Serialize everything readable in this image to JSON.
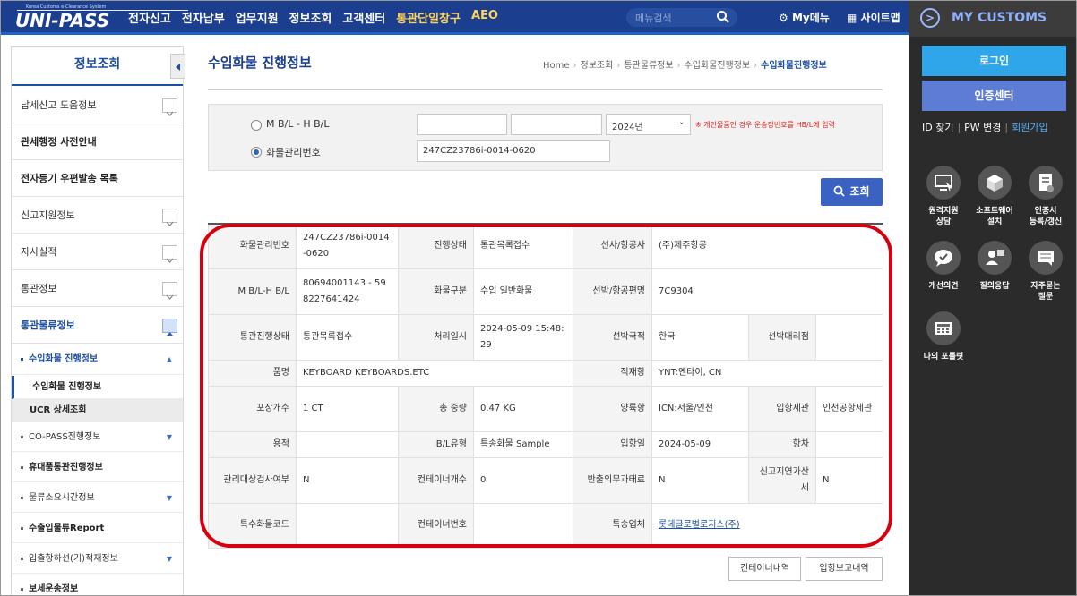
{
  "header": {
    "logo_sub": "Korea Customs e-Clearance System",
    "logo_main": "UNI-PASS",
    "nav": [
      "전자신고",
      "전자납부",
      "업무지원",
      "정보조회",
      "고객센터",
      "통관단일창구",
      "AEO"
    ],
    "search_placeholder": "메뉴검색",
    "my_menu": "My메뉴",
    "sitemap": "사이트맵"
  },
  "right_panel": {
    "title": "MY CUSTOMS",
    "login": "로그인",
    "cert_center": "인증센터",
    "links": {
      "id": "ID 찾기",
      "pw": "PW 변경",
      "join": "회원가입"
    },
    "quick": [
      {
        "label1": "원격지원",
        "label2": "상담",
        "icon": "remote-support-icon"
      },
      {
        "label1": "소프트웨어",
        "label2": "설치",
        "icon": "software-install-icon"
      },
      {
        "label1": "인증서",
        "label2": "등록/갱신",
        "icon": "certificate-icon"
      },
      {
        "label1": "개선의견",
        "label2": "",
        "icon": "feedback-icon"
      },
      {
        "label1": "질의응답",
        "label2": "",
        "icon": "qna-icon"
      },
      {
        "label1": "자주묻는",
        "label2": "질문",
        "icon": "faq-icon"
      },
      {
        "label1": "나의 포틀릿",
        "label2": "",
        "icon": "portlet-icon"
      }
    ]
  },
  "sidebar": {
    "title": "정보조회",
    "items": [
      {
        "label": "납세신고 도움정보"
      },
      {
        "label": "관세행정 사전안내"
      },
      {
        "label": "전자등기 우편발송 목록"
      },
      {
        "label": "신고지원정보"
      },
      {
        "label": "자사실적"
      },
      {
        "label": "통관정보"
      },
      {
        "label": "통관물류정보"
      }
    ],
    "subitems": [
      {
        "label": "수입화물 진행정보"
      },
      {
        "label": "수입화물 진행정보"
      },
      {
        "label": "UCR 상세조회"
      },
      {
        "label": "CO-PASS진행정보"
      },
      {
        "label": "휴대품통관진행정보"
      },
      {
        "label": "물류소요시간정보"
      },
      {
        "label": "수출입물류Report"
      },
      {
        "label": "입출항하선(기)적재정보"
      },
      {
        "label": "보세운송정보"
      }
    ]
  },
  "main": {
    "title": "수입화물 진행정보",
    "breadcrumb": [
      "Home",
      "정보조회",
      "통관물류정보",
      "수입화물진행정보",
      "수입화물진행정보"
    ],
    "search": {
      "opt1": "M B/L - H B/L",
      "opt2": "화물관리번호",
      "year": "2024년",
      "notice": "※ 개인물품인 경우 운송장번호를 HB/L에 입력",
      "cargo_no": "247CZ23786i-0014-0620",
      "button": "조회"
    },
    "table": {
      "r1": {
        "h1": "화물관리번호",
        "v1": "247CZ23786i-0014-0620",
        "h2": "진행상태",
        "v2": "통관목록접수",
        "h3": "선사/항공사",
        "v3": "(주)제주항공"
      },
      "r2": {
        "h1": "M B/L-H B/L",
        "v1": "80694001143 - 598227641424",
        "h2": "화물구분",
        "v2": "수입 일반화물",
        "h3": "선박/항공편명",
        "v3": "7C9304"
      },
      "r3": {
        "h1": "통관진행상태",
        "v1": "통관목록접수",
        "h2": "처리일시",
        "v2": "2024-05-09 15:48:29",
        "h3": "선박국적",
        "v3": "한국",
        "h4": "선박대리점",
        "v4": ""
      },
      "r4": {
        "h1": "품명",
        "v1": "KEYBOARD KEYBOARDS.ETC",
        "h3": "적재항",
        "v3": "YNT:옌타이, CN"
      },
      "r5": {
        "h1": "포장개수",
        "v1": "1 CT",
        "h2": "총 중량",
        "v2": "0.47 KG",
        "h3": "양륙항",
        "v3": "ICN:서울/인천",
        "h4": "입항세관",
        "v4": "인천공항세관"
      },
      "r6": {
        "h1": "용적",
        "v1": "",
        "h2": "B/L유형",
        "v2": "특송화물 Sample",
        "h3": "입항일",
        "v3": "2024-05-09",
        "h4": "항차",
        "v4": ""
      },
      "r7": {
        "h1": "관리대상검사여부",
        "v1": "N",
        "h2": "컨테이너개수",
        "v2": "0",
        "h3": "반출의무과태료",
        "v3": "N",
        "h4": "신고지연가산세",
        "v4": "N"
      },
      "r8": {
        "h1": "특수화물코드",
        "v1": "",
        "h2": "컨테이너번호",
        "v2": "",
        "h3": "특송업체",
        "v3": "롯데글로벌로지스(주)"
      }
    },
    "buttons": {
      "container": "컨테이너내역",
      "arrival": "입항보고내역"
    }
  },
  "colors": {
    "header": "#1b3e8e",
    "accent": "#1e50a2",
    "highlight_oval": "#d8000e",
    "login": "#2fa6ea",
    "cert": "#5d7cd4"
  }
}
